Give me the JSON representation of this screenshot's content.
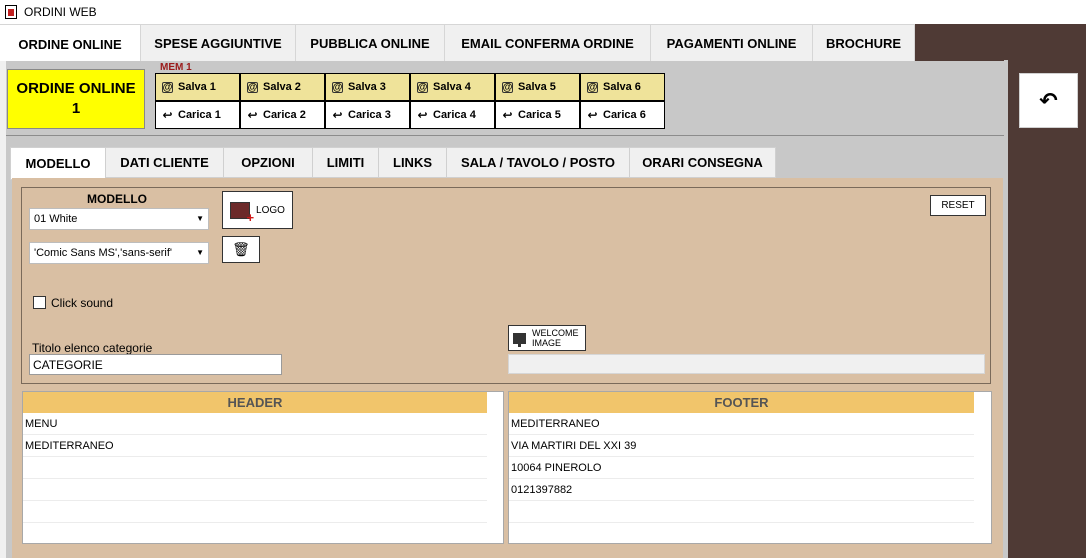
{
  "window": {
    "title": "ORDINI WEB"
  },
  "top_tabs": [
    {
      "label": "ORDINE ONLINE",
      "active": true
    },
    {
      "label": "SPESE AGGIUNTIVE"
    },
    {
      "label": "PUBBLICA ONLINE"
    },
    {
      "label": "EMAIL CONFERMA ORDINE"
    },
    {
      "label": "PAGAMENTI ONLINE"
    },
    {
      "label": "BROCHURE"
    }
  ],
  "order_box": {
    "line1": "ORDINE ONLINE",
    "line2": "1"
  },
  "memory": {
    "label": "MEM 1",
    "save": [
      "Salva 1",
      "Salva 2",
      "Salva 3",
      "Salva 4",
      "Salva 5",
      "Salva 6"
    ],
    "load": [
      "Carica 1",
      "Carica 2",
      "Carica 3",
      "Carica 4",
      "Carica 5",
      "Carica 6"
    ]
  },
  "sub_tabs": [
    {
      "label": "MODELLO",
      "active": true
    },
    {
      "label": "DATI CLIENTE"
    },
    {
      "label": "OPZIONI"
    },
    {
      "label": "LIMITI"
    },
    {
      "label": "LINKS"
    },
    {
      "label": "SALA / TAVOLO / POSTO"
    },
    {
      "label": "ORARI CONSEGNA"
    }
  ],
  "modello": {
    "label": "MODELLO",
    "model_select": "01 White",
    "font_select": "'Comic Sans MS','sans-serif'",
    "logo_label": "LOGO",
    "reset_label": "RESET",
    "click_sound_label": "Click sound",
    "click_sound_checked": false,
    "titolo_label": "Titolo elenco categorie",
    "titolo_value": "CATEGORIE",
    "welcome_label_1": "WELCOME",
    "welcome_label_2": "IMAGE",
    "welcome_value": ""
  },
  "header": {
    "title": "HEADER",
    "rows": [
      "MENU",
      "MEDITERRANEO",
      "",
      "",
      ""
    ]
  },
  "footer": {
    "title": "FOOTER",
    "rows": [
      "MEDITERRANEO",
      "VIA MARTIRI DEL XXI 39",
      "10064 PINEROLO",
      "0121397882",
      ""
    ]
  },
  "colors": {
    "accent_yellow": "#ffff00",
    "save_slot": "#efe39a",
    "table_header": "#f1c56b",
    "content_bg": "#d9bfa3",
    "dark_bg": "#4f3a35"
  },
  "icons": {
    "back": "undo-arrow-icon",
    "logo": "image-add-icon",
    "trash": "trash-icon",
    "welcome": "monitor-icon"
  }
}
